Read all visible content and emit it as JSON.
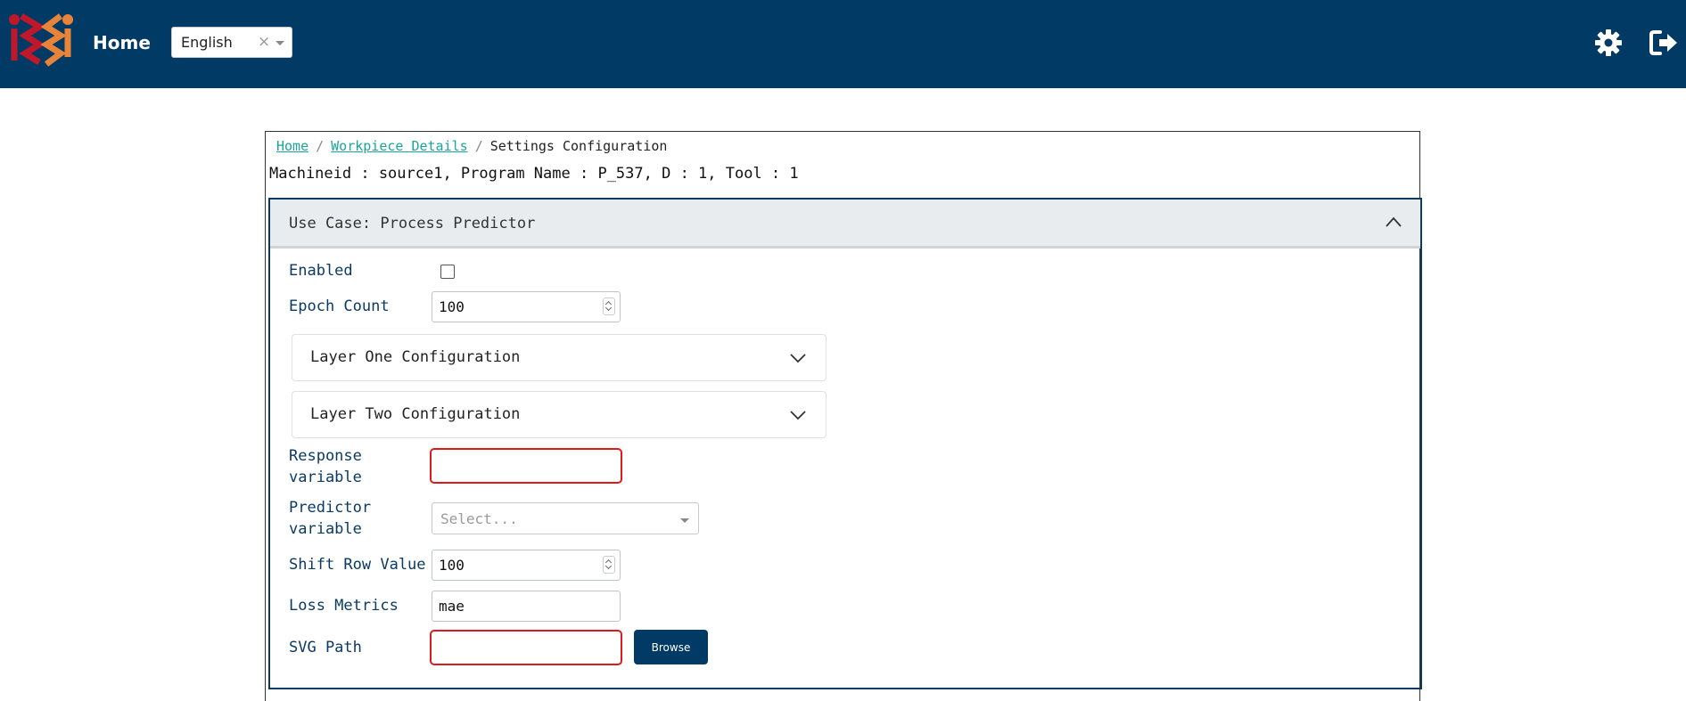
{
  "header": {
    "title": "Home",
    "language_value": "English",
    "language_clear": "×",
    "colors": {
      "background": "#023a66"
    }
  },
  "breadcrumb": {
    "home": "Home",
    "sep": "/",
    "workpiece": "Workpiece Details",
    "current": "Settings Configuration"
  },
  "machine_info": "Machineid : source1, Program Name : P_537, D : 1, Tool : 1",
  "use_case": {
    "title": "Use Case: Process Predictor",
    "enabled_label": "Enabled",
    "enabled_checked": false,
    "epoch_label": "Epoch Count",
    "epoch_value": "100",
    "layer_one": "Layer One Configuration",
    "layer_two": "Layer Two Configuration",
    "response_label_1": "Response",
    "response_label_2": "variable",
    "response_value": "",
    "predictor_label_1": "Predictor",
    "predictor_label_2": "variable",
    "predictor_placeholder": "Select...",
    "shift_label": "Shift Row Value",
    "shift_value": "100",
    "loss_label": "Loss Metrics",
    "loss_value": "mae",
    "svg_label": "SVG Path",
    "svg_value": "",
    "browse_label": "Browse"
  },
  "icons": {
    "logo": "app-logo",
    "settings": "gear-icon",
    "logout": "logout-icon",
    "collapse": "chevron-up-icon",
    "expand": "chevron-down-icon"
  },
  "colors": {
    "primary": "#023a66",
    "link": "#1aa69a",
    "error": "#e0191b",
    "label": "#0b3a63"
  }
}
